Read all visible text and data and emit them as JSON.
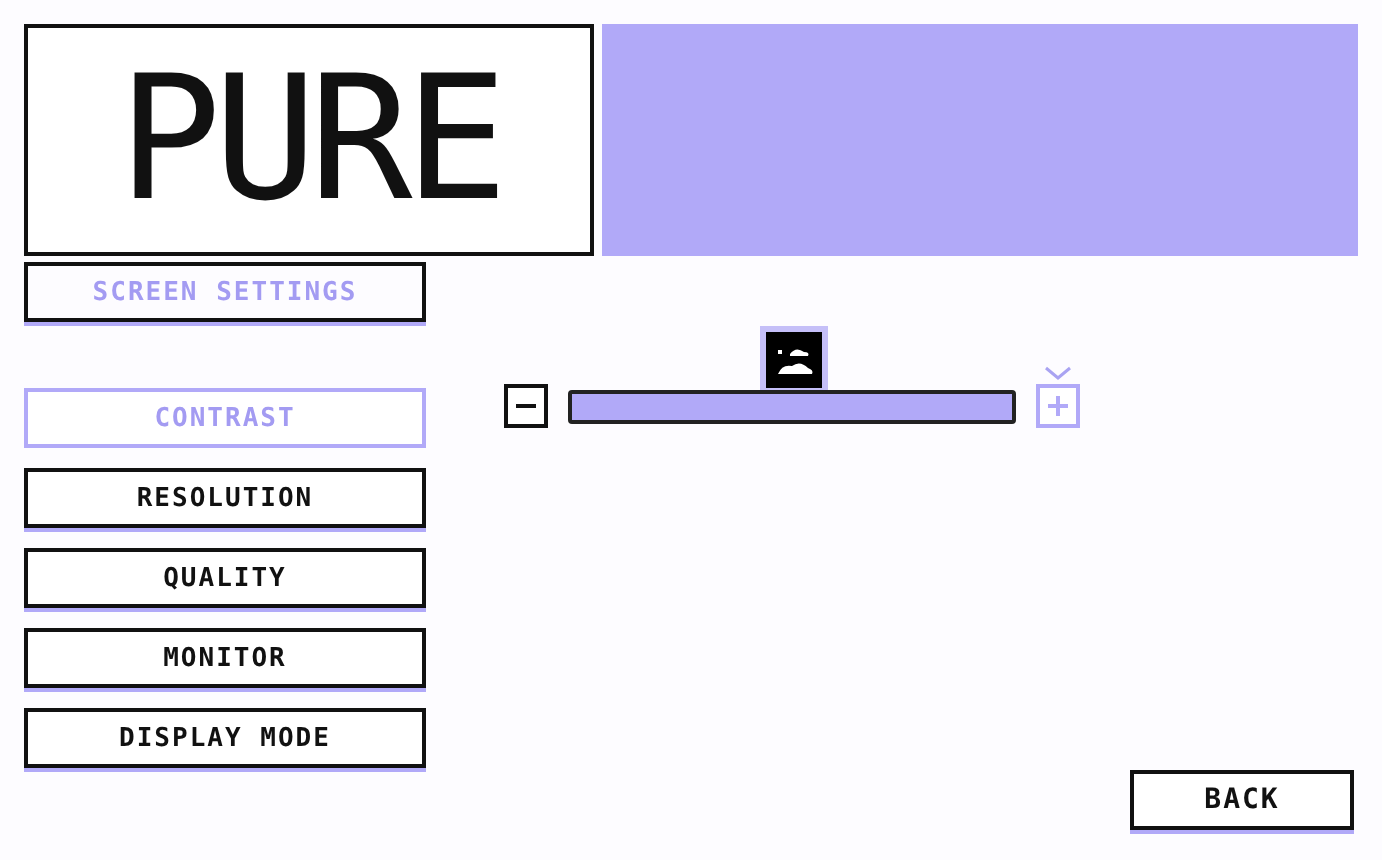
{
  "logo": {
    "text": "PURE"
  },
  "section_title": "SCREEN SETTINGS",
  "menu": [
    {
      "label": "CONTRAST",
      "selected": true
    },
    {
      "label": "RESOLUTION",
      "selected": false
    },
    {
      "label": "QUALITY",
      "selected": false
    },
    {
      "label": "MONITOR",
      "selected": false
    },
    {
      "label": "DISPLAY MODE",
      "selected": false
    }
  ],
  "slider": {
    "level": 1,
    "buttons": [
      {
        "kind": "decrease",
        "selected": false
      },
      {
        "kind": "increase",
        "selected": true
      }
    ]
  },
  "back_button": {
    "label": "BACK"
  }
}
